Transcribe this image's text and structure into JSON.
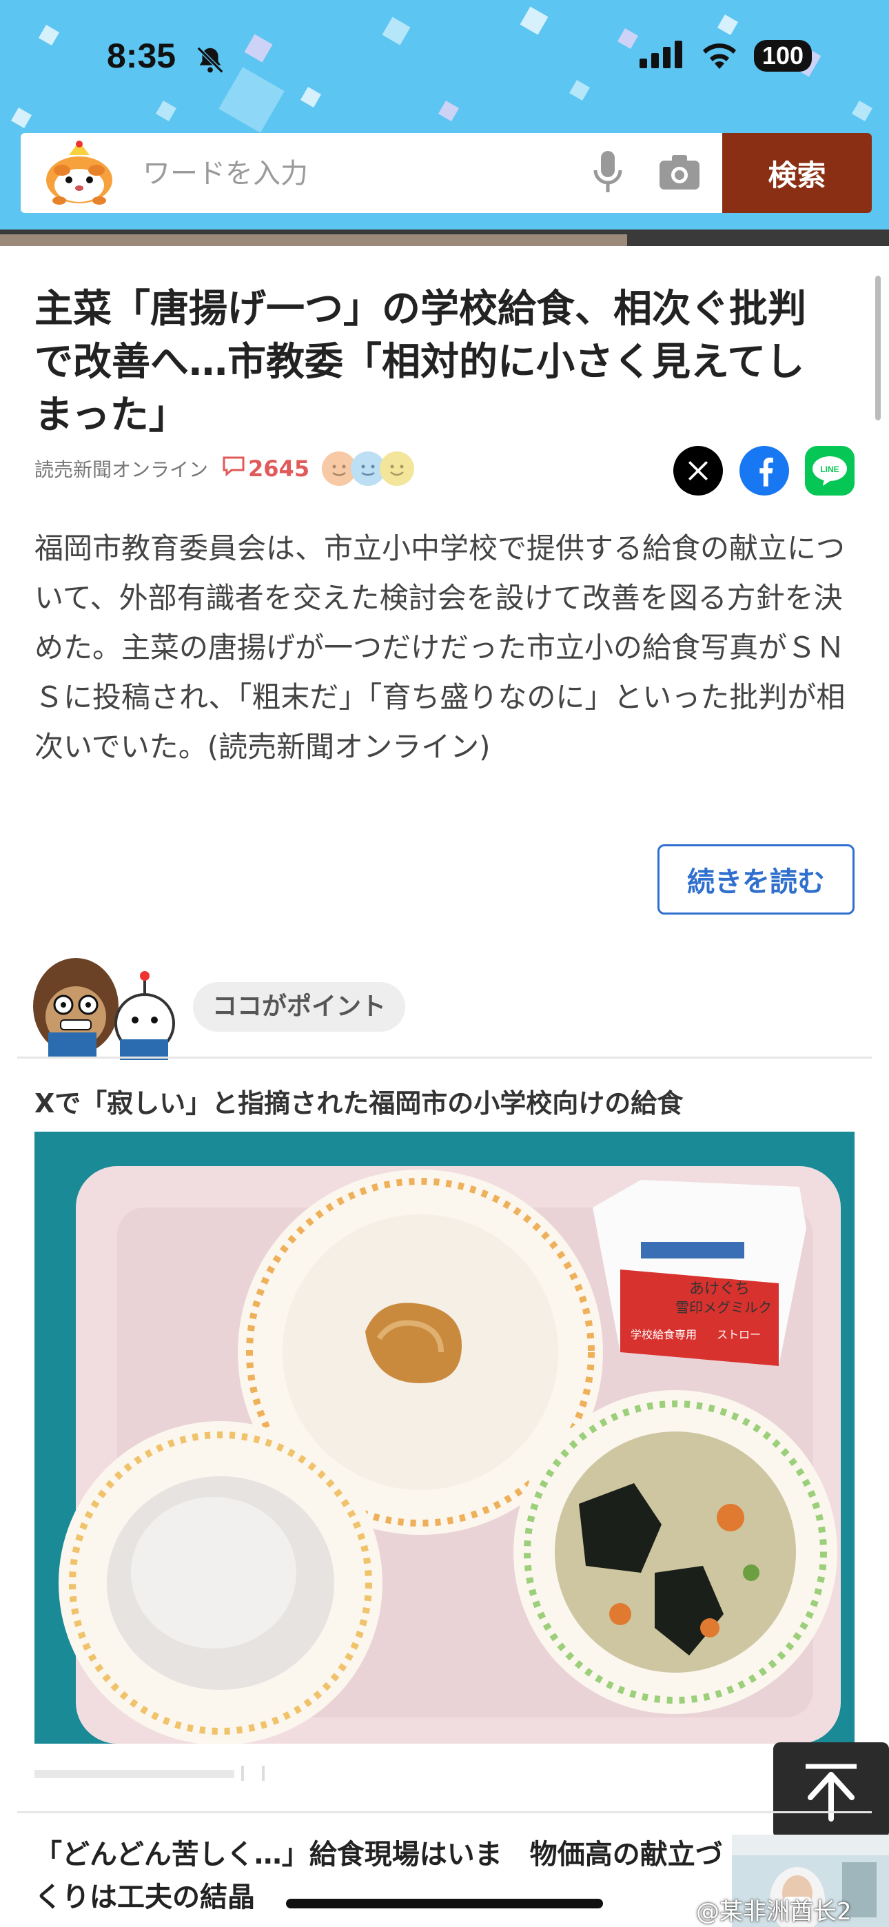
{
  "status_bar": {
    "time": "8:35",
    "battery": "100",
    "icons": [
      "bell-slash-icon",
      "signal-icon",
      "wifi-icon",
      "battery-icon"
    ]
  },
  "search": {
    "placeholder": "ワードを入力",
    "button_label": "検索",
    "icons": [
      "mascot-logo",
      "mic-icon",
      "camera-icon"
    ]
  },
  "article": {
    "title": "主菜「唐揚げ一つ」の学校給食、相次ぐ批判で改善へ…市教委「相対的に小さく見えてしまった」",
    "source": "読売新聞オンライン",
    "comment_count": "2645",
    "share_icons": [
      "x-icon",
      "facebook-icon",
      "line-icon"
    ],
    "body": "福岡市教育委員会は、市立小中学校で提供する給食の献立について、外部有識者を交えた検討会を設けて改善を図る方針を決めた。主菜の唐揚げが一つだけだった市立小の給食写真がＳＮＳに投稿され、「粗末だ」「育ち盛りなのに」といった批判が相次いでいた。(読売新聞オンライン)",
    "read_more": "続きを読む"
  },
  "point": {
    "label": "ココがポイント"
  },
  "photo": {
    "caption": "Xで「寂しい」と指摘された福岡市の小学校向けの給食",
    "milk_text": [
      "あけぐち",
      "雪印メグミルク",
      "学校給食専用",
      "ストロー"
    ]
  },
  "related": {
    "title": "「どんどん苦しく…」給食現場はいま　物価高の献立づくりは工夫の結晶"
  },
  "watermark": "@某非洲酋长2",
  "colors": {
    "header": "#5cc5f1",
    "search_button": "#8a2f13",
    "link_blue": "#2f6fce",
    "comment_red": "#e05a5a",
    "tray_teal": "#1a8a96"
  }
}
